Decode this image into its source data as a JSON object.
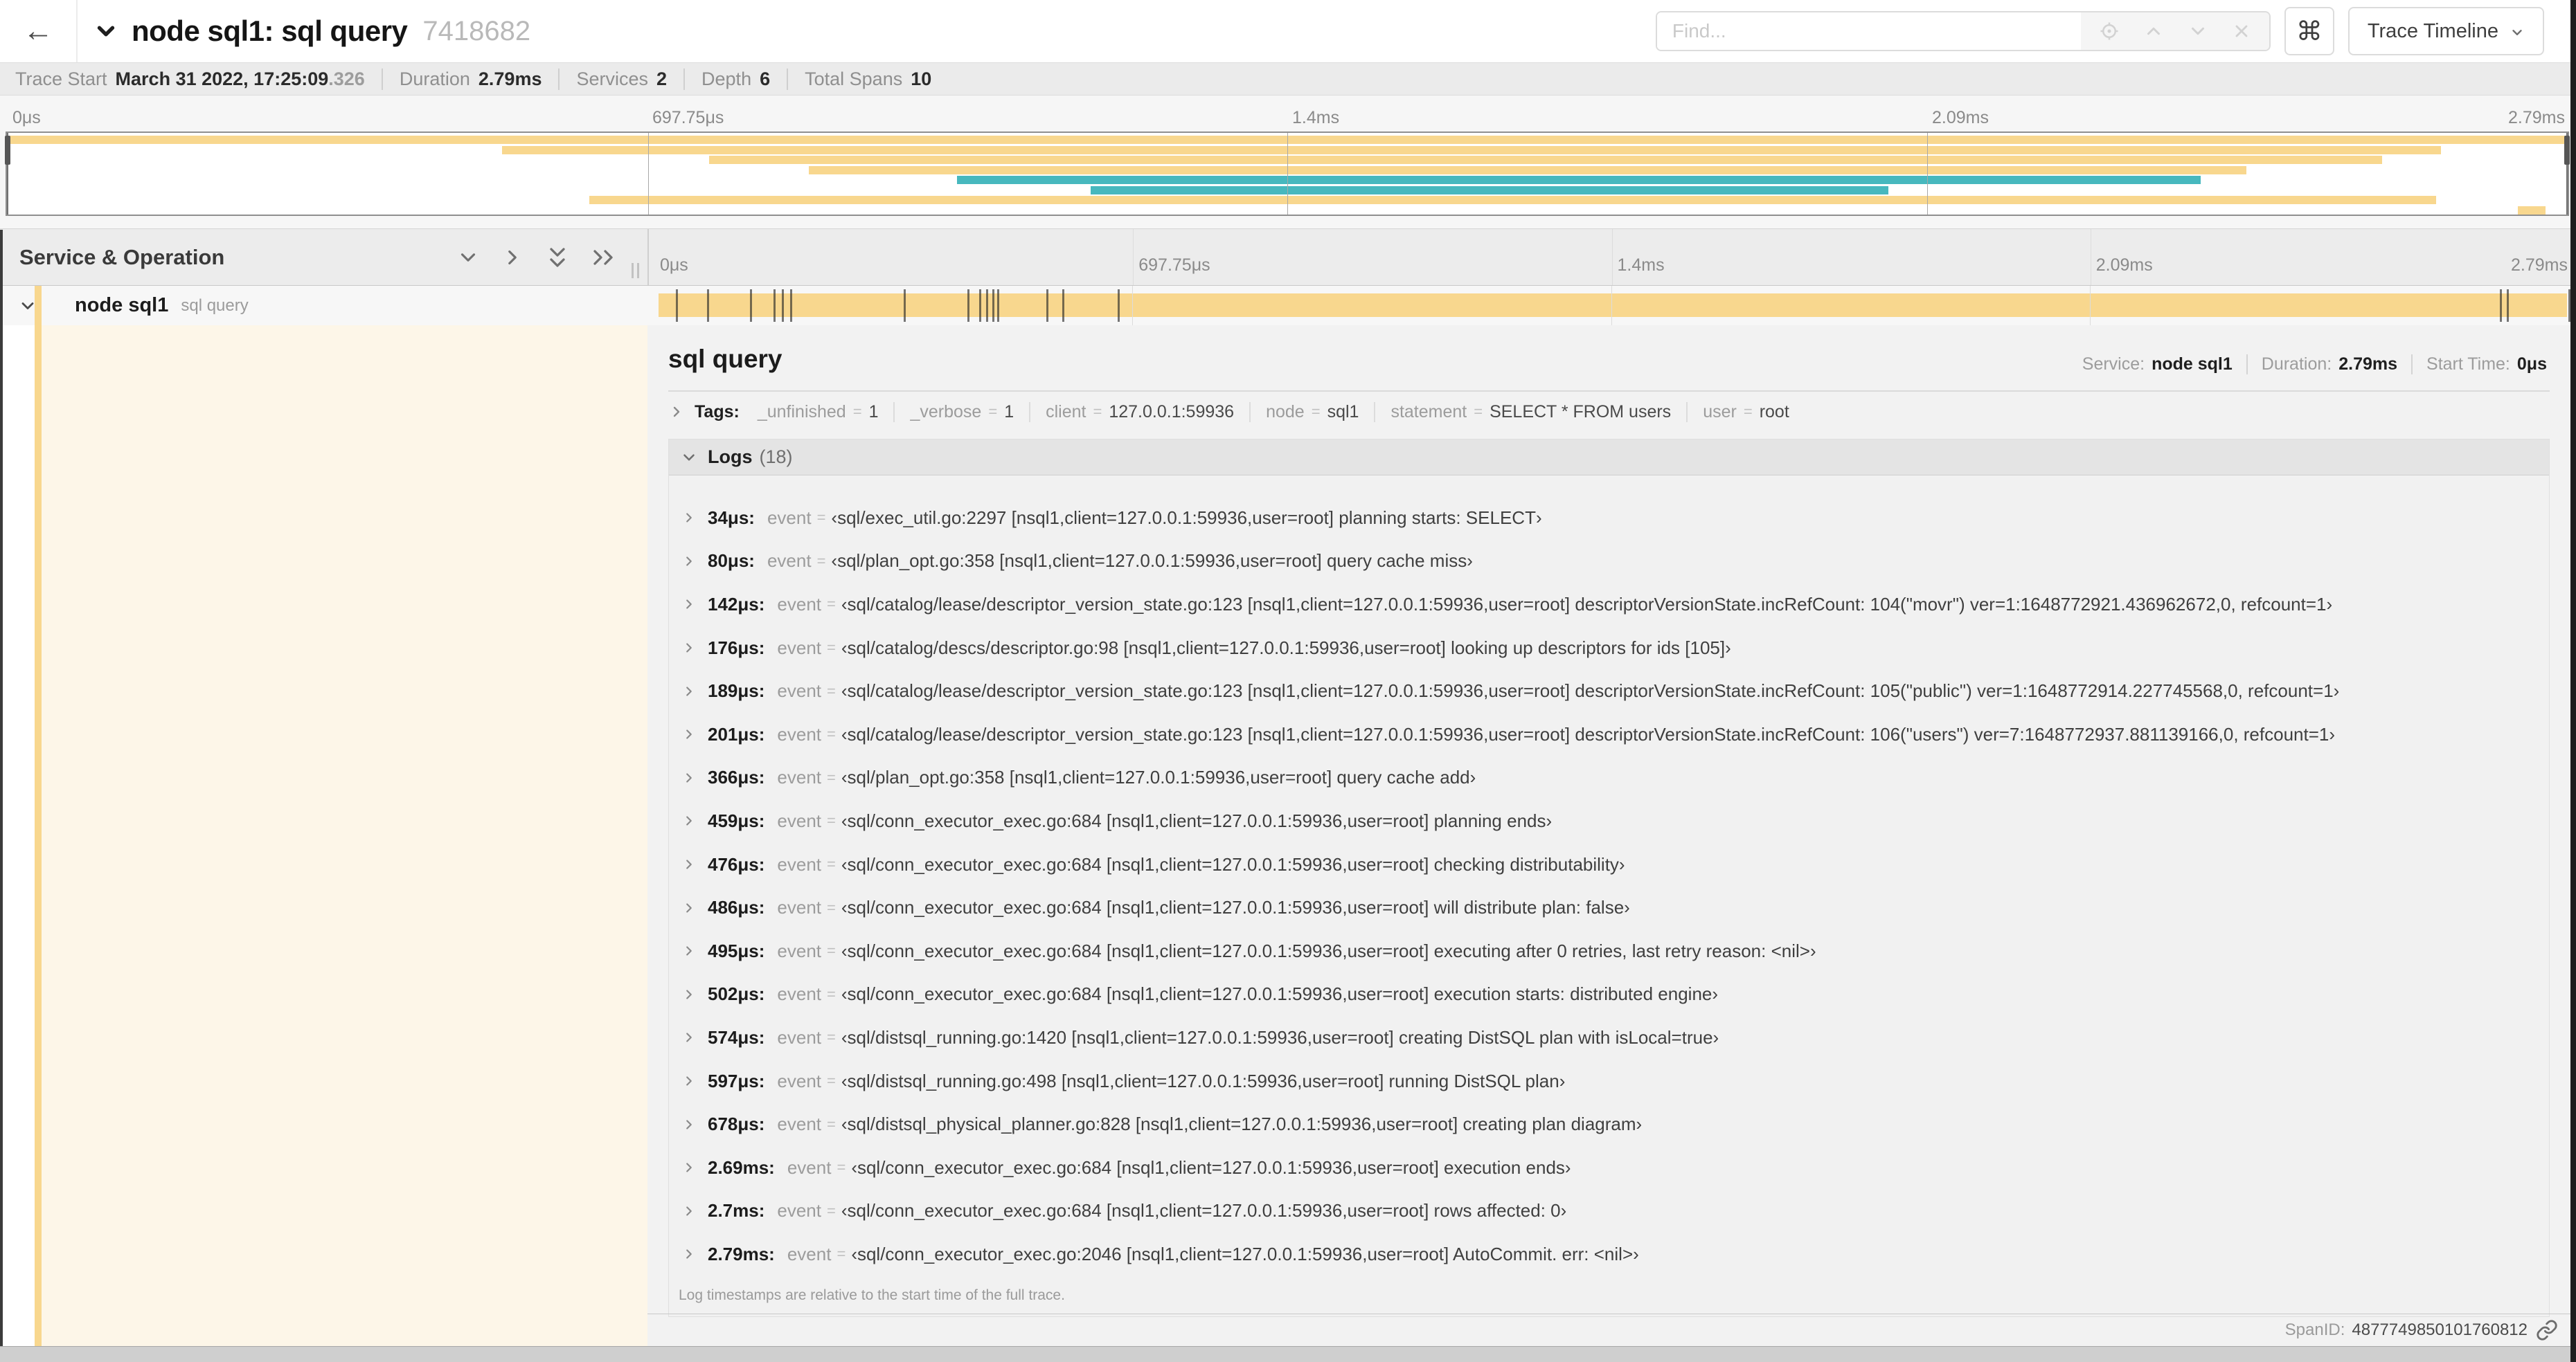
{
  "colors": {
    "span_tan": "#f8d78e",
    "span_teal": "#47b8be",
    "service_tint": "#fdf6e8"
  },
  "trace": {
    "duration_us": 2790
  },
  "header": {
    "back_icon": "←",
    "title": "node sql1: sql query",
    "trace_id": "7418682",
    "find_placeholder": "Find...",
    "shortcut_button": "⌘",
    "view_selector": "Trace Timeline"
  },
  "summary": {
    "items": [
      {
        "label": "Trace Start",
        "value": "March 31 2022, 17:25:09",
        "suffix": ".326"
      },
      {
        "label": "Duration",
        "value": "2.79ms"
      },
      {
        "label": "Services",
        "value": "2"
      },
      {
        "label": "Depth",
        "value": "6"
      },
      {
        "label": "Total Spans",
        "value": "10"
      }
    ]
  },
  "minimap": {
    "ticks": [
      {
        "label": "0μs",
        "pct": 0
      },
      {
        "label": "697.75μs",
        "pct": 25
      },
      {
        "label": "1.4ms",
        "pct": 50
      },
      {
        "label": "2.09ms",
        "pct": 75
      },
      {
        "label": "2.79ms",
        "pct": 100
      }
    ],
    "spans": [
      {
        "start": 0,
        "end": 100,
        "color": "tan"
      },
      {
        "start": 19.3,
        "end": 95.1,
        "color": "tan"
      },
      {
        "start": 27.4,
        "end": 92.8,
        "color": "tan"
      },
      {
        "start": 31.3,
        "end": 87.5,
        "color": "tan"
      },
      {
        "start": 37.1,
        "end": 85.7,
        "color": "teal"
      },
      {
        "start": 42.3,
        "end": 73.5,
        "color": "teal"
      },
      {
        "start": 22.7,
        "end": 94.9,
        "color": "tan"
      },
      {
        "start": 98.1,
        "end": 99.2,
        "color": "tan"
      }
    ]
  },
  "timeline": {
    "left_header": "Service & Operation",
    "ticks": [
      {
        "label": "0μs",
        "pct": 0
      },
      {
        "label": "697.75μs",
        "pct": 25
      },
      {
        "label": "1.4ms",
        "pct": 50
      },
      {
        "label": "2.09ms",
        "pct": 75
      },
      {
        "label": "2.79ms",
        "pct": 100
      }
    ],
    "row": {
      "service": "node sql1",
      "operation": "sql query"
    }
  },
  "detail": {
    "operation": "sql query",
    "meta": [
      {
        "label": "Service:",
        "value": "node sql1"
      },
      {
        "label": "Duration:",
        "value": "2.79ms"
      },
      {
        "label": "Start Time:",
        "value": "0μs"
      }
    ],
    "kv_separator": "=",
    "tags_label": "Tags:",
    "tags": [
      {
        "key": "_unfinished",
        "value": "1"
      },
      {
        "key": "_verbose",
        "value": "1"
      },
      {
        "key": "client",
        "value": "127.0.0.1:59936"
      },
      {
        "key": "node",
        "value": "sql1"
      },
      {
        "key": "statement",
        "value": "SELECT * FROM users"
      },
      {
        "key": "user",
        "value": "root"
      }
    ],
    "logs_title": "Logs",
    "logs_count": "(18)",
    "logs": [
      {
        "t": "34μs:",
        "t_us": 34,
        "key": "event",
        "value": "‹sql/exec_util.go:2297 [nsql1,client=127.0.0.1:59936,user=root] planning starts: SELECT›"
      },
      {
        "t": "80μs:",
        "t_us": 80,
        "key": "event",
        "value": "‹sql/plan_opt.go:358 [nsql1,client=127.0.0.1:59936,user=root] query cache miss›"
      },
      {
        "t": "142μs:",
        "t_us": 142,
        "key": "event",
        "value": "‹sql/catalog/lease/descriptor_version_state.go:123 [nsql1,client=127.0.0.1:59936,user=root] descriptorVersionState.incRefCount: 104(\"movr\") ver=1:1648772921.436962672,0, refcount=1›"
      },
      {
        "t": "176μs:",
        "t_us": 176,
        "key": "event",
        "value": "‹sql/catalog/descs/descriptor.go:98 [nsql1,client=127.0.0.1:59936,user=root] looking up descriptors for ids [105]›"
      },
      {
        "t": "189μs:",
        "t_us": 189,
        "key": "event",
        "value": "‹sql/catalog/lease/descriptor_version_state.go:123 [nsql1,client=127.0.0.1:59936,user=root] descriptorVersionState.incRefCount: 105(\"public\") ver=1:1648772914.227745568,0, refcount=1›"
      },
      {
        "t": "201μs:",
        "t_us": 201,
        "key": "event",
        "value": "‹sql/catalog/lease/descriptor_version_state.go:123 [nsql1,client=127.0.0.1:59936,user=root] descriptorVersionState.incRefCount: 106(\"users\") ver=7:1648772937.881139166,0, refcount=1›"
      },
      {
        "t": "366μs:",
        "t_us": 366,
        "key": "event",
        "value": "‹sql/plan_opt.go:358 [nsql1,client=127.0.0.1:59936,user=root] query cache add›"
      },
      {
        "t": "459μs:",
        "t_us": 459,
        "key": "event",
        "value": "‹sql/conn_executor_exec.go:684 [nsql1,client=127.0.0.1:59936,user=root] planning ends›"
      },
      {
        "t": "476μs:",
        "t_us": 476,
        "key": "event",
        "value": "‹sql/conn_executor_exec.go:684 [nsql1,client=127.0.0.1:59936,user=root] checking distributability›"
      },
      {
        "t": "486μs:",
        "t_us": 486,
        "key": "event",
        "value": "‹sql/conn_executor_exec.go:684 [nsql1,client=127.0.0.1:59936,user=root] will distribute plan: false›"
      },
      {
        "t": "495μs:",
        "t_us": 495,
        "key": "event",
        "value": "‹sql/conn_executor_exec.go:684 [nsql1,client=127.0.0.1:59936,user=root] executing after 0 retries, last retry reason: <nil>›"
      },
      {
        "t": "502μs:",
        "t_us": 502,
        "key": "event",
        "value": "‹sql/conn_executor_exec.go:684 [nsql1,client=127.0.0.1:59936,user=root] execution starts: distributed engine›"
      },
      {
        "t": "574μs:",
        "t_us": 574,
        "key": "event",
        "value": "‹sql/distsql_running.go:1420 [nsql1,client=127.0.0.1:59936,user=root] creating DistSQL plan with isLocal=true›"
      },
      {
        "t": "597μs:",
        "t_us": 597,
        "key": "event",
        "value": "‹sql/distsql_running.go:498 [nsql1,client=127.0.0.1:59936,user=root] running DistSQL plan›"
      },
      {
        "t": "678μs:",
        "t_us": 678,
        "key": "event",
        "value": "‹sql/distsql_physical_planner.go:828 [nsql1,client=127.0.0.1:59936,user=root] creating plan diagram›"
      },
      {
        "t": "2.69ms:",
        "t_us": 2690,
        "key": "event",
        "value": "‹sql/conn_executor_exec.go:684 [nsql1,client=127.0.0.1:59936,user=root] execution ends›"
      },
      {
        "t": "2.7ms:",
        "t_us": 2700,
        "key": "event",
        "value": "‹sql/conn_executor_exec.go:684 [nsql1,client=127.0.0.1:59936,user=root] rows affected: 0›"
      },
      {
        "t": "2.79ms:",
        "t_us": 2790,
        "key": "event",
        "value": "‹sql/conn_executor_exec.go:2046 [nsql1,client=127.0.0.1:59936,user=root] AutoCommit. err: <nil>›"
      }
    ],
    "logs_note": "Log timestamps are relative to the start time of the full trace.",
    "footer": {
      "label": "SpanID:",
      "value": "4877749850101760812"
    }
  }
}
